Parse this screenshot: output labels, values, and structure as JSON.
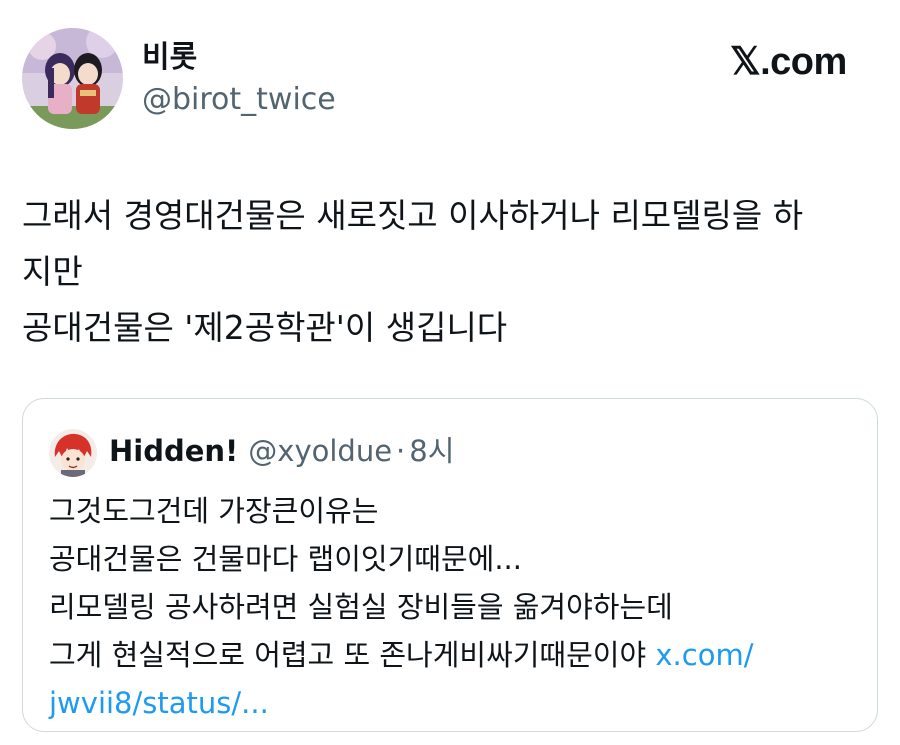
{
  "author": {
    "display_name": "비롯",
    "handle": "@birot_twice"
  },
  "brand": "𝕏.com",
  "tweet": {
    "lines": [
      "그래서 경영대건물은 새로짓고 이사하거나 리모델링을 하",
      "지만",
      "공대건물은 '제2공학관'이 생깁니다"
    ]
  },
  "quote": {
    "display_name": "Hidden!",
    "handle": "@xyoldue",
    "separator": "·",
    "time": "8시",
    "lines": [
      "그것도그건데 가장큰이유는",
      "공대건물은 건물마다 랩이잇기때문에...",
      "리모델링 공사하려면 실험실 장비들을 옮겨야하는데",
      "그게 현실적으로 어렵고 또 존나게비싸기때문이야"
    ],
    "link_part1": "x.com/",
    "link_part2": "jwvii8/status/..."
  },
  "colors": {
    "text": "#0f1419",
    "secondary": "#536471",
    "link": "#1d9bf0",
    "border": "#cfd9de"
  }
}
